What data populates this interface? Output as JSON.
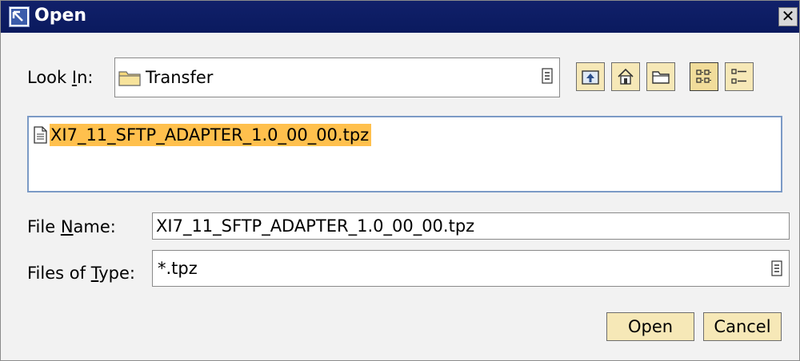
{
  "window": {
    "title": "Open",
    "icon": "open-dialog-icon",
    "close_label": "✕"
  },
  "look_in": {
    "label_pre": "Look ",
    "label_mnemonic": "I",
    "label_post": "n:",
    "value": "Transfer",
    "icon": "folder-icon"
  },
  "toolbar": {
    "buttons": [
      {
        "name": "up-one-level",
        "icon": "up-folder-icon"
      },
      {
        "name": "home",
        "icon": "home-icon"
      },
      {
        "name": "new-folder",
        "icon": "new-folder-icon"
      },
      {
        "name": "list-view",
        "icon": "list-view-icon",
        "pressed": true
      },
      {
        "name": "details-view",
        "icon": "details-view-icon",
        "pressed": false
      }
    ]
  },
  "file_list": {
    "items": [
      {
        "name": "XI7_11_SFTP_ADAPTER_1.0_00_00.tpz",
        "icon": "document-icon",
        "selected": true
      }
    ]
  },
  "file_name": {
    "label_pre": "File ",
    "label_mnemonic": "N",
    "label_post": "ame:",
    "value": "XI7_11_SFTP_ADAPTER_1.0_00_00.tpz"
  },
  "files_of_type": {
    "label_pre": "Files of ",
    "label_mnemonic": "T",
    "label_post": "ype:",
    "value": "*.tpz"
  },
  "buttons": {
    "open_label": "Open",
    "cancel_label": "Cancel"
  },
  "colors": {
    "titlebar": "#0a1a5e",
    "button_face": "#f6e8b7",
    "selection": "#ffc04d",
    "list_border": "#7b9ac6"
  }
}
